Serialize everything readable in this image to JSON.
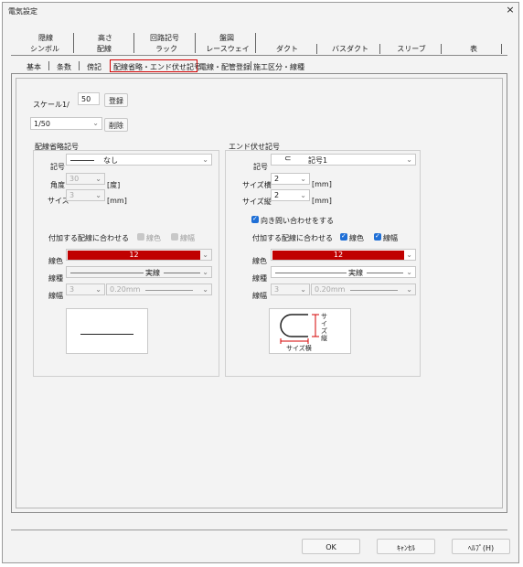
{
  "window": {
    "title": "電気設定",
    "close": "×"
  },
  "top_tabs_row1": [
    "隠線",
    "高さ",
    "回路記号",
    "盤図"
  ],
  "top_tabs_row2": [
    "シンボル",
    "配線",
    "ラック",
    "レースウェイ",
    "ダクト",
    "バスダクト",
    "スリーブ",
    "表"
  ],
  "sub_tabs": [
    "基本",
    "条数",
    "傍記",
    "配線省略・エンド伏せ記号",
    "電線・配管登録",
    "施工区分・線種"
  ],
  "active_sub_tab_index": 3,
  "scale": {
    "label": "スケール1/",
    "value": "50",
    "register_button": "登録",
    "selected": "1/50",
    "delete_button": "削除"
  },
  "left_group": {
    "title": "配線省略記号",
    "symbol_label": "記号",
    "symbol_value": "なし",
    "angle_label": "角度",
    "angle_value": "30",
    "angle_unit": "[度]",
    "size_label": "サイズ",
    "size_value": "3",
    "size_unit": "[mm]",
    "match_label": "付加する配線に合わせる",
    "color_check_label": "線色",
    "width_check_label": "線幅",
    "line_color_label": "線色",
    "line_color_value": "12",
    "line_type_label": "線種",
    "line_type_value": "実線",
    "line_width_label": "線幅",
    "line_width_num": "3",
    "line_width_mm": "0.20mm"
  },
  "right_group": {
    "title": "エンド伏せ記号",
    "symbol_label": "記号",
    "symbol_value": "記号1",
    "size_w_label": "サイズ横",
    "size_w_value": "2",
    "size_w_unit": "[mm]",
    "size_h_label": "サイズ縦",
    "size_h_value": "2",
    "size_h_unit": "[mm]",
    "facing_label": "向き問い合わせをする",
    "match_label": "付加する配線に合わせる",
    "color_check_label": "線色",
    "width_check_label": "線幅",
    "line_color_label": "線色",
    "line_color_value": "12",
    "line_type_label": "線種",
    "line_type_value": "実線",
    "line_width_label": "線幅",
    "line_width_num": "3",
    "line_width_mm": "0.20mm",
    "preview_vertical_text": "サイズ縦",
    "preview_horizontal_text": "サイズ横"
  },
  "footer": {
    "ok": "OK",
    "cancel": "ｷｬﾝｾﾙ",
    "help": "ﾍﾙﾌﾟ(H)"
  },
  "colors": {
    "accent_red": "#c00000",
    "check_blue": "#1f6fd6",
    "active_tab_border": "#d40000"
  }
}
